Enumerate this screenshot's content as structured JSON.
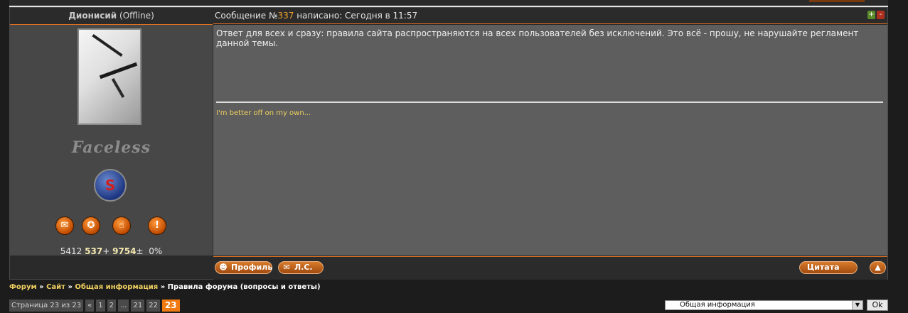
{
  "post": {
    "author": {
      "name": "Дионисий",
      "status": "(Offline)",
      "rank_title": "Faceless",
      "stats": {
        "posts": "5412",
        "reputation": "537",
        "reputation_sign": "+",
        "awards": "9754",
        "awards_sign": "±",
        "warnings": "0%"
      }
    },
    "header": {
      "prefix": "Сообщение №",
      "number": "337",
      "suffix": " написано: Сегодня в 11:57"
    },
    "message": "Ответ для всех и сразу: правила сайта распространяются на всех пользователей без исключений. Это всё - прошу, не нарушайте регламент данной темы.",
    "signature": "I'm better off on my own...",
    "buttons": {
      "profile": "Профиль",
      "pm": "Л.С.",
      "quote": "Цитата"
    },
    "rating": {
      "up": "+",
      "down": "-"
    },
    "icons": {
      "badge": "S",
      "chat": "chat-icon",
      "award": "award-icon",
      "rep": "reputation-icon",
      "warn": "!"
    }
  },
  "breadcrumbs": {
    "forum": "Форум",
    "site": "Сайт",
    "section": "Общая информация",
    "sep": " » ",
    "current": "Правила форума (вопросы и ответы)"
  },
  "pager": {
    "label": "Страница 23 из 23",
    "prev": "«",
    "pages": [
      "1",
      "2",
      "...",
      "21",
      "22"
    ],
    "current": "23"
  },
  "jump": {
    "selected": "Общая информация",
    "ok": "Ok"
  },
  "colors": {
    "accent": "#e07020",
    "link": "#f0d060",
    "body": "#5e5e5e"
  }
}
